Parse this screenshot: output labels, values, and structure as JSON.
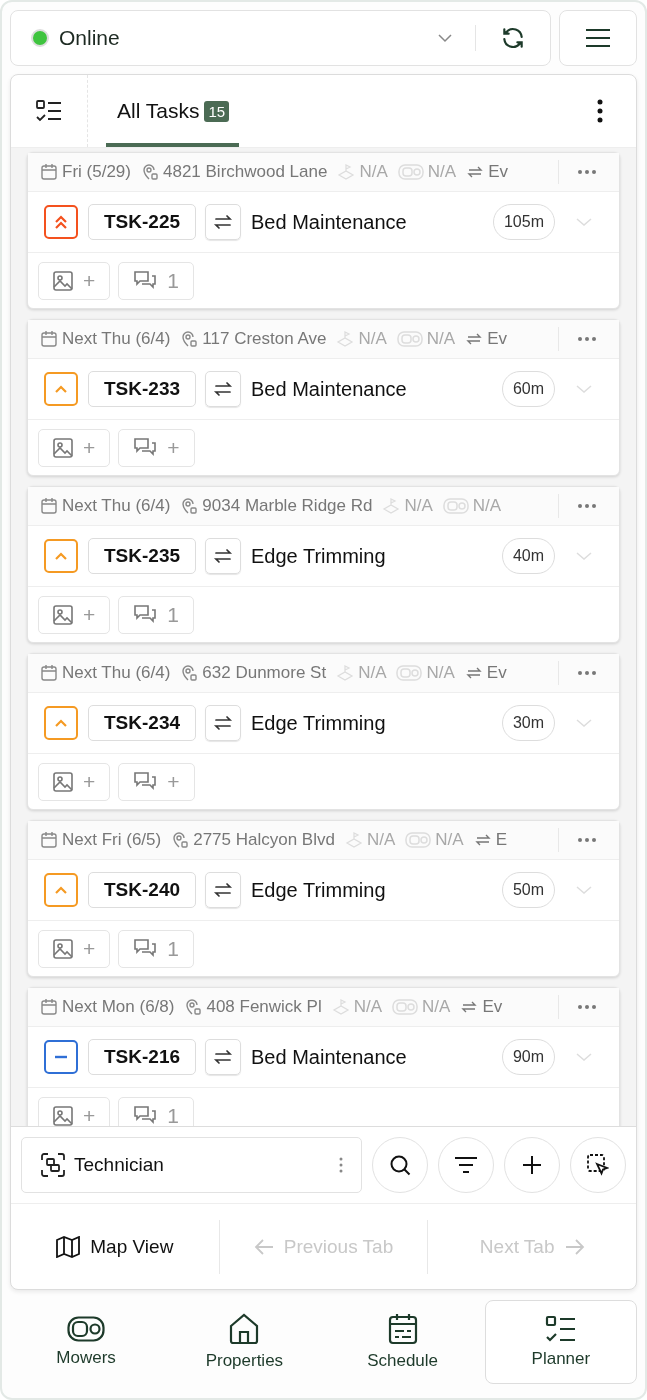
{
  "status": {
    "label": "Online",
    "online": true
  },
  "tabs": [
    {
      "label": "All Tasks",
      "count": "15",
      "selected": true
    }
  ],
  "tasks": [
    {
      "date": "Fri (5/29)",
      "address": "4821 Birchwood Lane",
      "zone": "N/A",
      "mower": "N/A",
      "recurrence": "Ev",
      "kind": "urgent",
      "id": "TSK-225",
      "name": "Bed Maintenance",
      "duration": "105m",
      "photos": "+",
      "comments": "1"
    },
    {
      "date": "Next Thu (6/4)",
      "address": "117 Creston Ave",
      "zone": "N/A",
      "mower": "N/A",
      "recurrence": "Ev",
      "kind": "high",
      "id": "TSK-233",
      "name": "Bed Maintenance",
      "duration": "60m",
      "photos": "+",
      "comments": "+"
    },
    {
      "date": "Next Thu (6/4)",
      "address": "9034 Marble Ridge Rd",
      "zone": "N/A",
      "mower": "N/A",
      "kind": "high",
      "id": "TSK-235",
      "name": "Edge Trimming",
      "duration": "40m",
      "photos": "+",
      "comments": "1"
    },
    {
      "date": "Next Thu (6/4)",
      "address": "632 Dunmore St",
      "zone": "N/A",
      "mower": "N/A",
      "recurrence": "Ev",
      "kind": "high",
      "id": "TSK-234",
      "name": "Edge Trimming",
      "duration": "30m",
      "photos": "+",
      "comments": "+"
    },
    {
      "date": "Next Fri (6/5)",
      "address": "2775 Halcyon Blvd",
      "zone": "N/A",
      "mower": "N/A",
      "recurrence": "E",
      "kind": "high",
      "id": "TSK-240",
      "name": "Edge Trimming",
      "duration": "50m",
      "photos": "+",
      "comments": "1"
    },
    {
      "date": "Next Mon (6/8)",
      "address": "408 Fenwick Pl",
      "zone": "N/A",
      "mower": "N/A",
      "recurrence": "Ev",
      "kind": "medium",
      "id": "TSK-216",
      "name": "Bed Maintenance",
      "duration": "90m",
      "photos": "+",
      "comments": "1"
    }
  ],
  "toolbar": {
    "view": "Technician"
  },
  "nav_row": [
    {
      "label": "Map View",
      "disabled": false,
      "kind": "map"
    },
    {
      "label": "Previous Tab",
      "disabled": true,
      "kind": "prev"
    },
    {
      "label": "Next Tab",
      "disabled": true,
      "kind": "next"
    }
  ],
  "bottom_nav": [
    {
      "label": "Mowers",
      "selected": false
    },
    {
      "label": "Properties",
      "selected": false
    },
    {
      "label": "Schedule",
      "selected": false
    },
    {
      "label": "Planner",
      "selected": true
    }
  ]
}
